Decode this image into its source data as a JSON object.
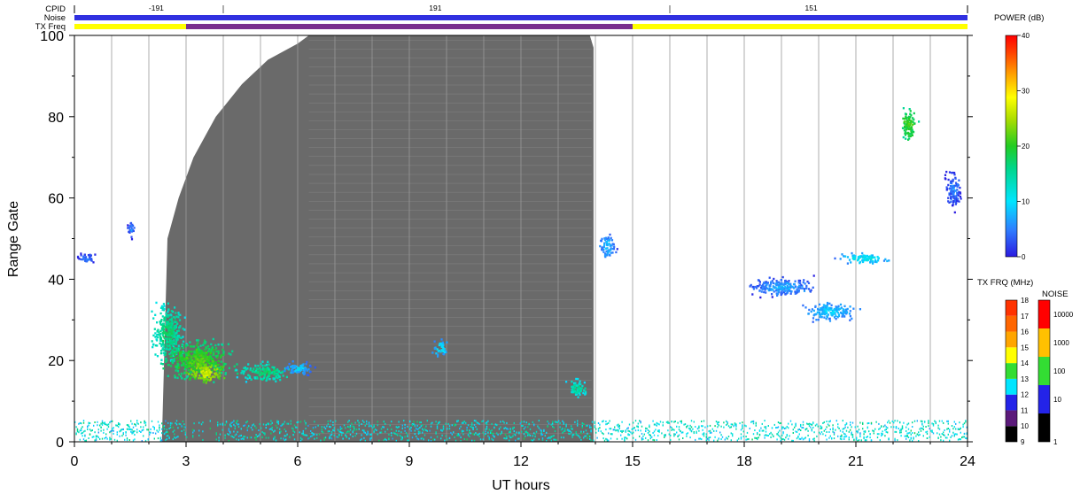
{
  "chart_data": {
    "type": "heatmap",
    "xlabel": "UT hours",
    "ylabel": "Range Gate",
    "xlim": [
      0,
      24
    ],
    "ylim": [
      0,
      100
    ],
    "xticks": [
      "0",
      "3",
      "6",
      "9",
      "12",
      "15",
      "18",
      "21",
      "24"
    ],
    "yticks": [
      "0",
      "20",
      "40",
      "60",
      "80",
      "100"
    ],
    "top_panel": {
      "rows": [
        "CPID",
        "Noise",
        "TX Freq"
      ],
      "cpid_labels": [
        {
          "hour": 2.2,
          "text": "-191"
        },
        {
          "hour": 9.7,
          "text": "191"
        },
        {
          "hour": 19.8,
          "text": "151"
        }
      ],
      "cpid_boundaries": [
        4,
        16
      ],
      "tx_freq_segments": [
        {
          "start": 0,
          "end": 3,
          "color": "#ffff00"
        },
        {
          "start": 3,
          "end": 15,
          "color": "#7a2e8e"
        },
        {
          "start": 15,
          "end": 24,
          "color": "#ffff00"
        }
      ],
      "noise_color": "#3030e0"
    },
    "night_region": {
      "color": "#6a6a6a",
      "points": [
        [
          2.35,
          0
        ],
        [
          2.5,
          50
        ],
        [
          2.8,
          60
        ],
        [
          3.2,
          70
        ],
        [
          3.8,
          80
        ],
        [
          4.5,
          88
        ],
        [
          5.2,
          94
        ],
        [
          6.0,
          98
        ],
        [
          6.3,
          100
        ],
        [
          13.85,
          100
        ],
        [
          13.95,
          97
        ],
        [
          13.95,
          0
        ]
      ]
    },
    "blobs": [
      {
        "hour": 2.5,
        "gate": 27,
        "rx": 0.55,
        "ry": 9,
        "power": 18
      },
      {
        "hour": 3.3,
        "gate": 20,
        "rx": 1.2,
        "ry": 6,
        "power": 22
      },
      {
        "hour": 3.5,
        "gate": 17,
        "rx": 0.6,
        "ry": 3.5,
        "power": 27
      },
      {
        "hour": 5.1,
        "gate": 17,
        "rx": 0.9,
        "ry": 3,
        "power": 18
      },
      {
        "hour": 6.0,
        "gate": 18,
        "rx": 0.5,
        "ry": 2.5,
        "power": 10
      },
      {
        "hour": 9.8,
        "gate": 23,
        "rx": 0.25,
        "ry": 2.5,
        "power": 12
      },
      {
        "hour": 13.5,
        "gate": 13,
        "rx": 0.35,
        "ry": 3,
        "power": 16
      },
      {
        "hour": 14.3,
        "gate": 48,
        "rx": 0.3,
        "ry": 4,
        "power": 9
      },
      {
        "hour": 19.0,
        "gate": 38,
        "rx": 1.2,
        "ry": 3,
        "power": 8
      },
      {
        "hour": 20.3,
        "gate": 32,
        "rx": 0.9,
        "ry": 3,
        "power": 10
      },
      {
        "hour": 21.2,
        "gate": 45,
        "rx": 0.9,
        "ry": 1.6,
        "power": 12
      },
      {
        "hour": 22.4,
        "gate": 78,
        "rx": 0.3,
        "ry": 5,
        "power": 22
      },
      {
        "hour": 0.3,
        "gate": 45,
        "rx": 0.3,
        "ry": 2,
        "power": 6
      },
      {
        "hour": 1.5,
        "gate": 52,
        "rx": 0.15,
        "ry": 3,
        "power": 6
      },
      {
        "hour": 23.6,
        "gate": 62,
        "rx": 0.3,
        "ry": 6,
        "power": 6
      }
    ],
    "near_range": {
      "gate_max": 5,
      "power": 12
    },
    "power_scale": {
      "title": "POWER (dB)",
      "min": 0,
      "max": 40,
      "ticks": [
        "0",
        "10",
        "20",
        "30",
        "40"
      ]
    },
    "txfreq_scale": {
      "title": "TX FRQ (MHz)",
      "ticks": [
        "9",
        "10",
        "11",
        "12",
        "13",
        "14",
        "15",
        "16",
        "17",
        "18"
      ],
      "colors": [
        "#000000",
        "#5b1a7a",
        "#2323e8",
        "#00e5ff",
        "#33dd33",
        "#ffff00",
        "#ffa500",
        "#ff6600",
        "#ff3300",
        "#ff0000"
      ]
    },
    "noise_scale": {
      "title": "NOISE",
      "ticks": [
        "1",
        "10",
        "100",
        "1000",
        "10000"
      ],
      "colors": [
        "#000000",
        "#2323e8",
        "#33dd33",
        "#ffc000",
        "#ff0000"
      ]
    }
  }
}
